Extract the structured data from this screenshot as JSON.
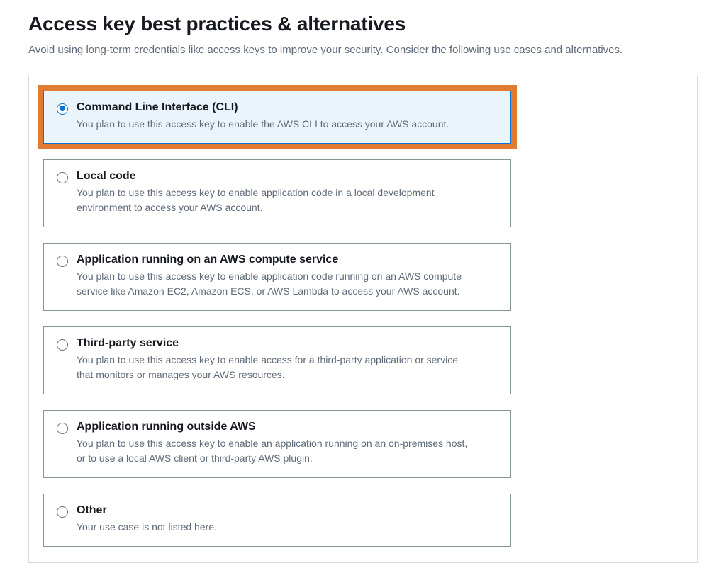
{
  "header": {
    "title": "Access key best practices & alternatives",
    "subtitle": "Avoid using long-term credentials like access keys to improve your security. Consider the following use cases and alternatives."
  },
  "options": [
    {
      "id": "cli",
      "label": "Command Line Interface (CLI)",
      "description": "You plan to use this access key to enable the AWS CLI to access your AWS account.",
      "selected": true,
      "highlighted": true
    },
    {
      "id": "local-code",
      "label": "Local code",
      "description": "You plan to use this access key to enable application code in a local development environment to access your AWS account.",
      "selected": false,
      "highlighted": false
    },
    {
      "id": "aws-compute",
      "label": "Application running on an AWS compute service",
      "description": "You plan to use this access key to enable application code running on an AWS compute service like Amazon EC2, Amazon ECS, or AWS Lambda to access your AWS account.",
      "selected": false,
      "highlighted": false
    },
    {
      "id": "third-party",
      "label": "Third-party service",
      "description": "You plan to use this access key to enable access for a third-party application or service that monitors or manages your AWS resources.",
      "selected": false,
      "highlighted": false
    },
    {
      "id": "outside-aws",
      "label": "Application running outside AWS",
      "description": "You plan to use this access key to enable an application running on an on-premises host, or to use a local AWS client or third-party AWS plugin.",
      "selected": false,
      "highlighted": false
    },
    {
      "id": "other",
      "label": "Other",
      "description": "Your use case is not listed here.",
      "selected": false,
      "highlighted": false
    }
  ],
  "colors": {
    "accent": "#0972d3",
    "highlight_frame": "#e07b2f",
    "text_secondary": "#5f6b7a",
    "border": "#879596"
  }
}
